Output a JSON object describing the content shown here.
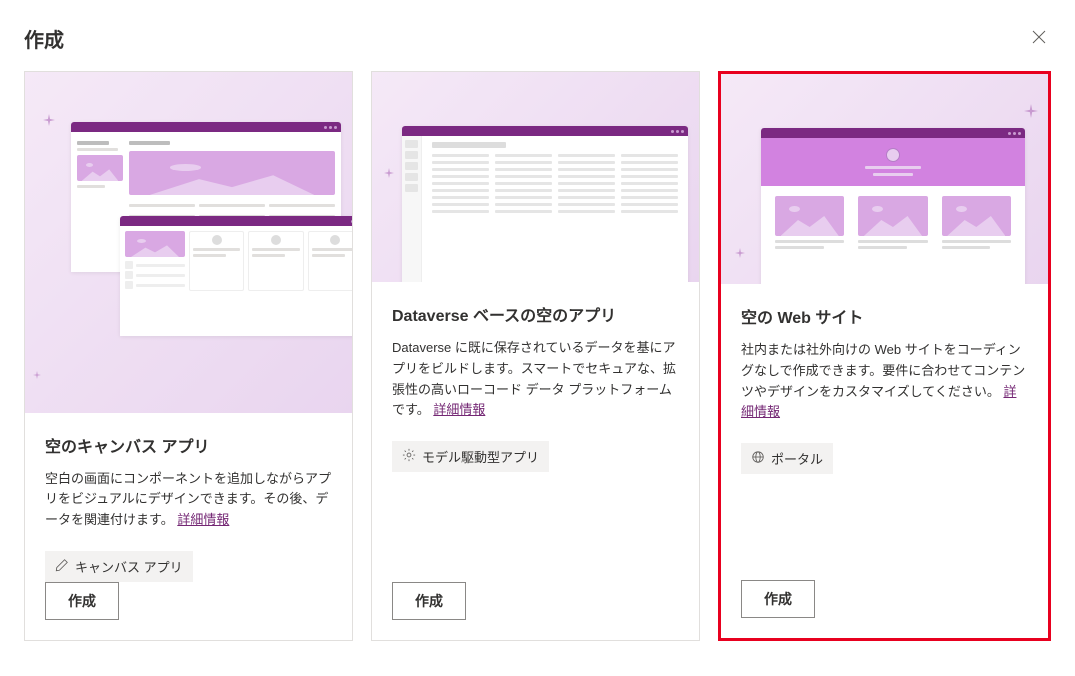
{
  "header": {
    "title": "作成"
  },
  "cards": [
    {
      "title": "空のキャンバス アプリ",
      "description": "空白の画面にコンポーネントを追加しながらアプリをビジュアルにデザインできます。その後、データを関連付けます。 ",
      "info_link": "詳細情報",
      "tag_icon": "pencil-icon",
      "tag_label": "キャンバス アプリ",
      "button": "作成"
    },
    {
      "title": "Dataverse ベースの空のアプリ",
      "description": "Dataverse に既に保存されているデータを基にアプリをビルドします。スマートでセキュアな、拡張性の高いローコード データ プラットフォームです。 ",
      "info_link": "詳細情報",
      "tag_icon": "gear-icon",
      "tag_label": "モデル駆動型アプリ",
      "button": "作成"
    },
    {
      "title": "空の Web サイト",
      "description": "社内または社外向けの Web サイトをコーディングなしで作成できます。要件に合わせてコンテンツやデザインをカスタマイズしてください。 ",
      "info_link": "詳細情報",
      "tag_icon": "globe-icon",
      "tag_label": "ポータル",
      "button": "作成"
    }
  ]
}
